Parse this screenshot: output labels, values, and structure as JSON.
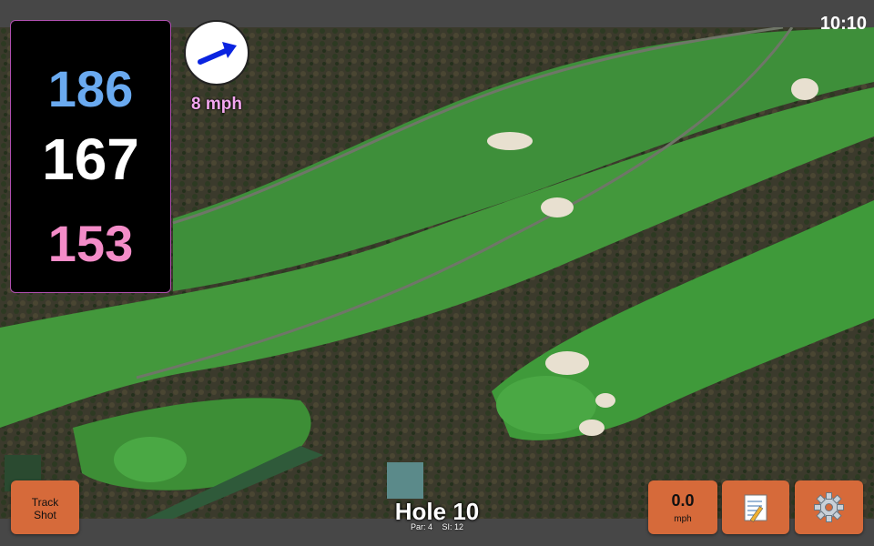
{
  "clock": "10:10",
  "distances": {
    "back": "186",
    "middle": "167",
    "front": "153"
  },
  "wind": {
    "speed_label": "8 mph",
    "direction_icon": "wind-arrow-icon",
    "arrow_color": "#0a24e0"
  },
  "hole": {
    "title": "Hole 10",
    "par_label": "Par: 4",
    "si_label": "SI: 12"
  },
  "buttons": {
    "track_shot": "Track Shot",
    "speed_value": "0.0",
    "speed_unit": "mph",
    "notes_icon": "notepad-icon",
    "settings_icon": "gear-icon"
  },
  "colors": {
    "back": "#6aaaf0",
    "middle": "#ffffff",
    "front": "#f48cc8",
    "button": "#d66a3a",
    "fairway": "#3f9a3a",
    "rough": "#2f6a2c",
    "trees": "#3a3a28",
    "sand": "#e8e0d0"
  }
}
